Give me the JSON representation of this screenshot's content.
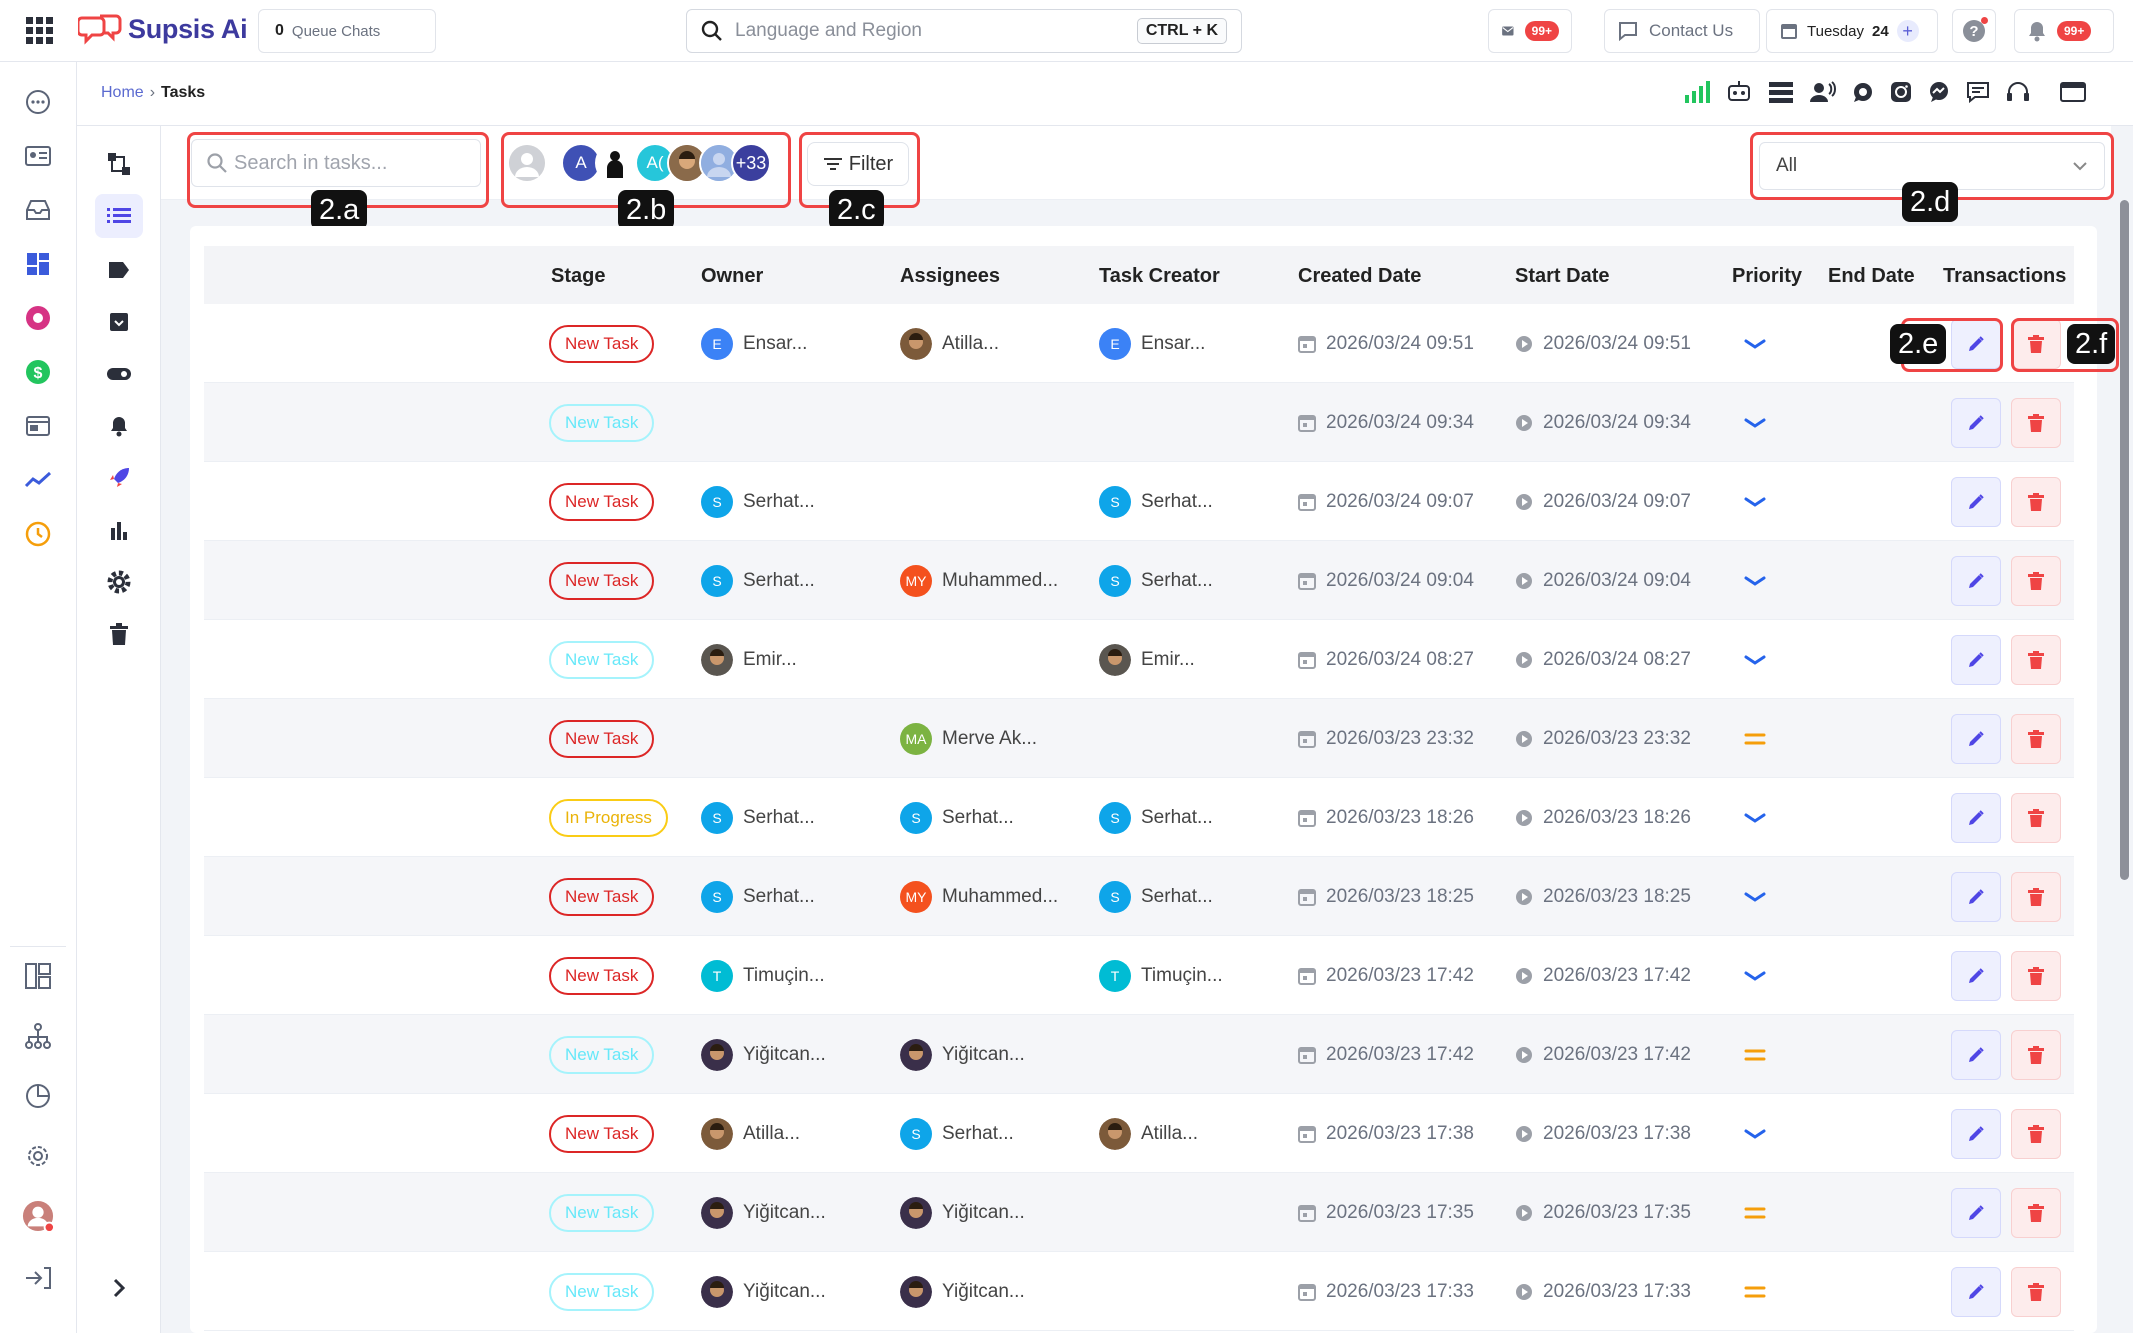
{
  "topbar": {
    "brand": "Supsis Ai",
    "queue_count": "0",
    "queue_label": "Queue Chats",
    "search_placeholder": "Language and Region",
    "search_shortcut": "CTRL + K",
    "mail_badge": "99+",
    "contact_label": "Contact Us",
    "date_day": "Tuesday",
    "date_num": "24",
    "notif_badge": "99+"
  },
  "breadcrumb": {
    "home": "Home",
    "sep": "›",
    "current": "Tasks"
  },
  "toolbar": {
    "search_placeholder": "Search in tasks...",
    "avatars": [
      "",
      "A",
      "",
      "A(",
      "",
      "",
      "+33"
    ],
    "more_count": "+33",
    "filter_label": "Filter",
    "select_value": "All"
  },
  "annotations": {
    "a": "2.a",
    "b": "2.b",
    "c": "2.c",
    "d": "2.d",
    "e": "2.e",
    "f": "2.f"
  },
  "columns": [
    "Stage",
    "Owner",
    "Assignees",
    "Task Creator",
    "Created Date",
    "Start Date",
    "Priority",
    "End Date",
    "Transactions"
  ],
  "colors": {
    "accent": "#5b5fd6",
    "danger": "#ef4444",
    "stage_new": "#dc2626",
    "priority_low": "#2563eb",
    "priority_medium": "#f59e0b"
  },
  "rows": [
    {
      "stage": "New Task",
      "stage_style": "new",
      "owner": {
        "name": "Ensar...",
        "initial": "E",
        "color": "#3b82f6"
      },
      "assignee": {
        "name": "Atilla...",
        "initial": "",
        "color": "#7c5a3a"
      },
      "creator": {
        "name": "Ensar...",
        "initial": "E",
        "color": "#3b82f6"
      },
      "created": "2026/03/24 09:51",
      "start": "2026/03/24 09:51",
      "priority": "low"
    },
    {
      "stage": "New Task",
      "stage_style": "faded",
      "owner": null,
      "assignee": null,
      "creator": null,
      "created": "2026/03/24 09:34",
      "start": "2026/03/24 09:34",
      "priority": "low"
    },
    {
      "stage": "New Task",
      "stage_style": "new",
      "owner": {
        "name": "Serhat...",
        "initial": "S",
        "color": "#0ea5e9"
      },
      "assignee": null,
      "creator": {
        "name": "Serhat...",
        "initial": "S",
        "color": "#0ea5e9"
      },
      "created": "2026/03/24 09:07",
      "start": "2026/03/24 09:07",
      "priority": "low"
    },
    {
      "stage": "New Task",
      "stage_style": "new",
      "owner": {
        "name": "Serhat...",
        "initial": "S",
        "color": "#0ea5e9"
      },
      "assignee": {
        "name": "Muhammed...",
        "initial": "MY",
        "color": "#f4511e"
      },
      "creator": {
        "name": "Serhat...",
        "initial": "S",
        "color": "#0ea5e9"
      },
      "created": "2026/03/24 09:04",
      "start": "2026/03/24 09:04",
      "priority": "low"
    },
    {
      "stage": "New Task",
      "stage_style": "faded",
      "owner": {
        "name": "Emir...",
        "initial": "",
        "color": "#5a5650"
      },
      "assignee": null,
      "creator": {
        "name": "Emir...",
        "initial": "",
        "color": "#5a5650"
      },
      "created": "2026/03/24 08:27",
      "start": "2026/03/24 08:27",
      "priority": "low"
    },
    {
      "stage": "New Task",
      "stage_style": "new",
      "owner": null,
      "assignee": {
        "name": "Merve Ak...",
        "initial": "MA",
        "color": "#7cb342"
      },
      "creator": null,
      "created": "2026/03/23 23:32",
      "start": "2026/03/23 23:32",
      "priority": "medium"
    },
    {
      "stage": "In Progress",
      "stage_style": "prog",
      "owner": {
        "name": "Serhat...",
        "initial": "S",
        "color": "#0ea5e9"
      },
      "assignee": {
        "name": "Serhat...",
        "initial": "S",
        "color": "#0ea5e9"
      },
      "creator": {
        "name": "Serhat...",
        "initial": "S",
        "color": "#0ea5e9"
      },
      "created": "2026/03/23 18:26",
      "start": "2026/03/23 18:26",
      "priority": "low"
    },
    {
      "stage": "New Task",
      "stage_style": "new",
      "owner": {
        "name": "Serhat...",
        "initial": "S",
        "color": "#0ea5e9"
      },
      "assignee": {
        "name": "Muhammed...",
        "initial": "MY",
        "color": "#f4511e"
      },
      "creator": {
        "name": "Serhat...",
        "initial": "S",
        "color": "#0ea5e9"
      },
      "created": "2026/03/23 18:25",
      "start": "2026/03/23 18:25",
      "priority": "low"
    },
    {
      "stage": "New Task",
      "stage_style": "new",
      "owner": {
        "name": "Timuçin...",
        "initial": "T",
        "color": "#00bcd4"
      },
      "assignee": null,
      "creator": {
        "name": "Timuçin...",
        "initial": "T",
        "color": "#00bcd4"
      },
      "created": "2026/03/23 17:42",
      "start": "2026/03/23 17:42",
      "priority": "low"
    },
    {
      "stage": "New Task",
      "stage_style": "faded",
      "owner": {
        "name": "Yiğitcan...",
        "initial": "",
        "color": "#3a2f4a"
      },
      "assignee": {
        "name": "Yiğitcan...",
        "initial": "",
        "color": "#3a2f4a"
      },
      "creator": null,
      "created": "2026/03/23 17:42",
      "start": "2026/03/23 17:42",
      "priority": "medium"
    },
    {
      "stage": "New Task",
      "stage_style": "new",
      "owner": {
        "name": "Atilla...",
        "initial": "",
        "color": "#7c5a3a"
      },
      "assignee": {
        "name": "Serhat...",
        "initial": "S",
        "color": "#0ea5e9"
      },
      "creator": {
        "name": "Atilla...",
        "initial": "",
        "color": "#7c5a3a"
      },
      "created": "2026/03/23 17:38",
      "start": "2026/03/23 17:38",
      "priority": "low"
    },
    {
      "stage": "New Task",
      "stage_style": "faded",
      "owner": {
        "name": "Yiğitcan...",
        "initial": "",
        "color": "#3a2f4a"
      },
      "assignee": {
        "name": "Yiğitcan...",
        "initial": "",
        "color": "#3a2f4a"
      },
      "creator": null,
      "created": "2026/03/23 17:35",
      "start": "2026/03/23 17:35",
      "priority": "medium"
    },
    {
      "stage": "New Task",
      "stage_style": "faded",
      "owner": {
        "name": "Yiğitcan...",
        "initial": "",
        "color": "#3a2f4a"
      },
      "assignee": {
        "name": "Yiğitcan...",
        "initial": "",
        "color": "#3a2f4a"
      },
      "creator": null,
      "created": "2026/03/23 17:33",
      "start": "2026/03/23 17:33",
      "priority": "medium"
    }
  ]
}
